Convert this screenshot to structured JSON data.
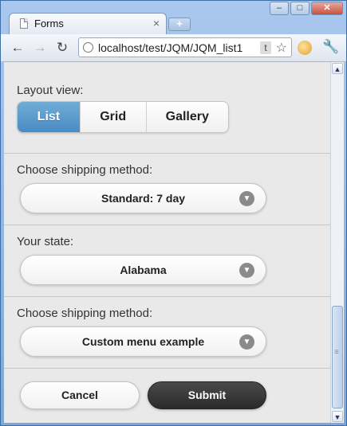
{
  "browser": {
    "tab_title": "Forms",
    "tab_close": "×",
    "new_tab": "+",
    "window_buttons": [
      "–",
      "□",
      "✕"
    ],
    "url": "localhost/test/JQM/JQM_list1",
    "url_badge": "t",
    "nav": {
      "back": "←",
      "forward": "→",
      "reload": "↻"
    },
    "star": "☆",
    "wrench": "🔧"
  },
  "scrollbar": {
    "up": "▲",
    "down": "▼"
  },
  "form": {
    "layout_label": "Layout view:",
    "layout_options": [
      "List",
      "Grid",
      "Gallery"
    ],
    "layout_selected": "List",
    "shipping1_label": "Choose shipping method:",
    "shipping1_value": "Standard: 7 day",
    "state_label": "Your state:",
    "state_value": "Alabama",
    "shipping2_label": "Choose shipping method:",
    "shipping2_value": "Custom menu example",
    "chevron": "▼",
    "cancel_label": "Cancel",
    "submit_label": "Submit"
  }
}
